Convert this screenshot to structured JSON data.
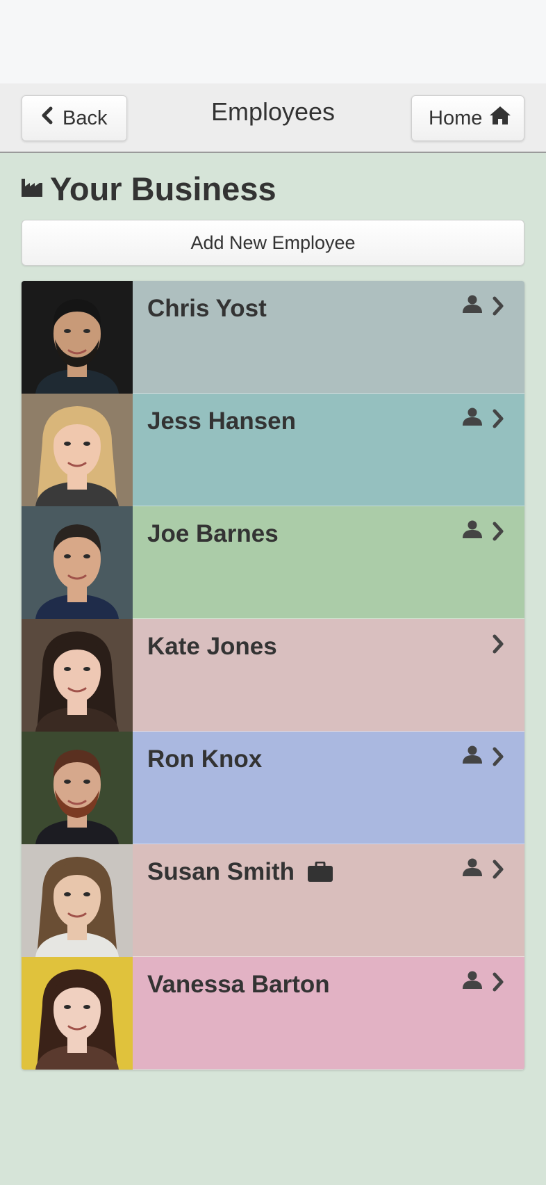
{
  "header": {
    "title": "Employees",
    "back_label": "Back",
    "home_label": "Home"
  },
  "business": {
    "title": "Your Business"
  },
  "add_button": {
    "label": "Add New Employee"
  },
  "employees": [
    {
      "name": "Chris Yost",
      "color": "#aebfbf",
      "has_person_icon": true,
      "has_briefcase": false
    },
    {
      "name": "Jess Hansen",
      "color": "#95c0bf",
      "has_person_icon": true,
      "has_briefcase": false
    },
    {
      "name": "Joe Barnes",
      "color": "#abcca8",
      "has_person_icon": true,
      "has_briefcase": false
    },
    {
      "name": "Kate Jones",
      "color": "#d9bfbf",
      "has_person_icon": false,
      "has_briefcase": false
    },
    {
      "name": "Ron Knox",
      "color": "#aab8e0",
      "has_person_icon": true,
      "has_briefcase": false
    },
    {
      "name": "Susan Smith",
      "color": "#d9bebc",
      "has_person_icon": true,
      "has_briefcase": true
    },
    {
      "name": "Vanessa Barton",
      "color": "#e2b2c4",
      "has_person_icon": true,
      "has_briefcase": false
    }
  ]
}
